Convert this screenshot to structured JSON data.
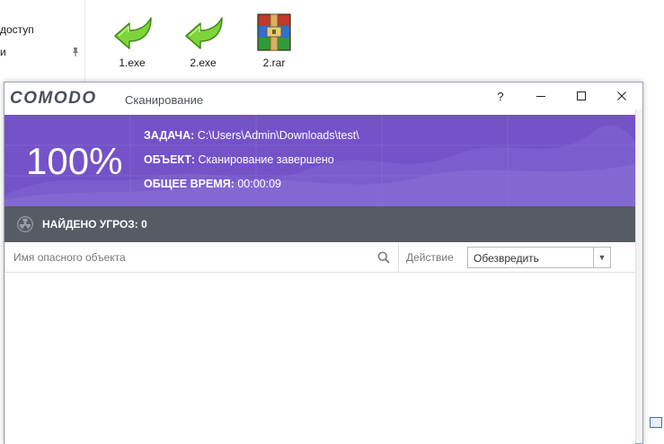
{
  "explorer": {
    "nav_items": [
      "доступ",
      "и"
    ],
    "files": [
      {
        "name": "1.exe",
        "icon": "green-arrow-icon"
      },
      {
        "name": "2.exe",
        "icon": "green-arrow-icon"
      },
      {
        "name": "2.rar",
        "icon": "winrar-archive-icon"
      }
    ]
  },
  "window": {
    "brand": "COMODO",
    "title": "Сканирование",
    "controls": {
      "help": "?"
    }
  },
  "scan": {
    "progress": "100%",
    "task_label": "ЗАДАЧА:",
    "task_value": "C:\\Users\\Admin\\Downloads\\test\\",
    "object_label": "ОБЪЕКТ:",
    "object_value": "Сканирование завершено",
    "time_label": "ОБЩЕЕ ВРЕМЯ:",
    "time_value": "00:00:09"
  },
  "threats": {
    "label": "НАЙДЕНО УГРОЗ:",
    "count": "0"
  },
  "filter": {
    "search_placeholder": "Имя опасного объекта",
    "action_label": "Действие",
    "action_selected": "Обезвредить"
  },
  "colors": {
    "accent_purple": "#7452c8",
    "threat_bar": "#575c64",
    "brand_text": "#4a4f59"
  }
}
